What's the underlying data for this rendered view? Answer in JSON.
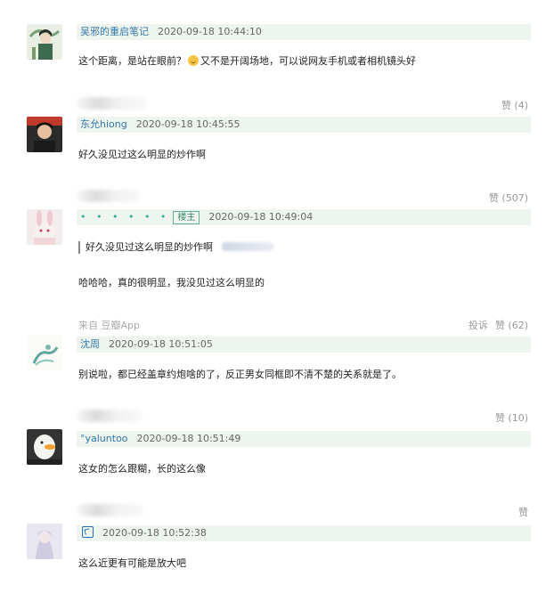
{
  "comments": [
    {
      "author": "吴邪的重启笔记",
      "time": "2020-09-18 10:44:10",
      "text_a": "这个距离，是站在眼前？",
      "emoji": "grinning-face-emoji",
      "text_b": "又不是开阔场地，可以说网友手机或者相机镜头好",
      "like": "赞 (4)"
    },
    {
      "author": "东允hiong",
      "time": "2020-09-18 10:45:55",
      "text": "好久没见过这么明显的炒作啊",
      "like": "赞 (507)"
    },
    {
      "author_dots": "• • • • • •",
      "badge": "楼主",
      "time": "2020-09-18 10:49:04",
      "quote": "好久没见过这么明显的炒作啊",
      "text": "哈哈哈，真的很明显，我没见过这么明显的",
      "source": "来自 豆瓣App",
      "report": "投诉",
      "like": "赞 (62)"
    },
    {
      "author": "沈周",
      "time": "2020-09-18 10:51:05",
      "text": "别说啦，都已经盖章约炮啥的了，反正男女同框即不清不楚的关系就是了。",
      "like": "赞 (10)"
    },
    {
      "author": "°yaluntoo",
      "time": "2020-09-18 10:51:49",
      "text": "这女的怎么跟糊，长的这么像",
      "like": "赞"
    },
    {
      "time": "2020-09-18 10:52:38",
      "text": "这么近更有可能是放大吧"
    }
  ]
}
